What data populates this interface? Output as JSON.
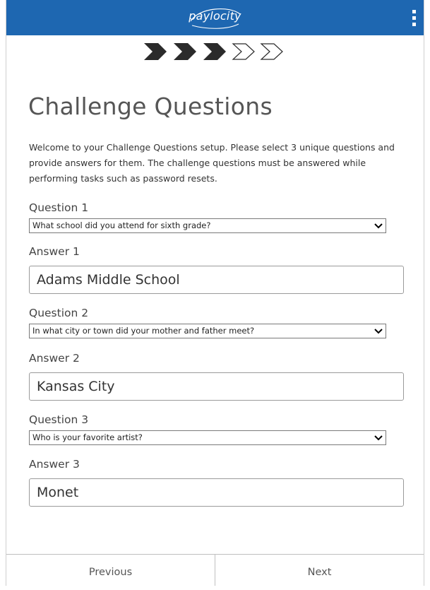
{
  "app": {
    "brand": "paylocity"
  },
  "colors": {
    "header_bg": "#1e67b1",
    "step_done": "#2b2b2b",
    "step_todo": "#2b2b2b",
    "text": "#333333"
  },
  "icons": {
    "menu": "kebab-menu-icon",
    "select_arrow": "chevron-down-icon",
    "step_complete": "filled-chevron-icon",
    "step_incomplete": "outline-chevron-icon"
  },
  "progress": {
    "total_steps": 5,
    "completed_steps": 3
  },
  "page": {
    "title": "Challenge Questions",
    "intro": "Welcome to your Challenge Questions setup. Please select 3 unique questions and provide answers for them. The challenge questions must be answered while performing tasks such as password resets."
  },
  "form": {
    "items": [
      {
        "question_label": "Question 1",
        "question_value": "What school did you attend for sixth grade?",
        "answer_label": "Answer 1",
        "answer_value": "Adams Middle School"
      },
      {
        "question_label": "Question 2",
        "question_value": "In what city or town did your mother and father meet?",
        "answer_label": "Answer 2",
        "answer_value": "Kansas City"
      },
      {
        "question_label": "Question 3",
        "question_value": "Who is your favorite artist?",
        "answer_label": "Answer 3",
        "answer_value": "Monet"
      }
    ]
  },
  "footer": {
    "previous_label": "Previous",
    "next_label": "Next"
  }
}
